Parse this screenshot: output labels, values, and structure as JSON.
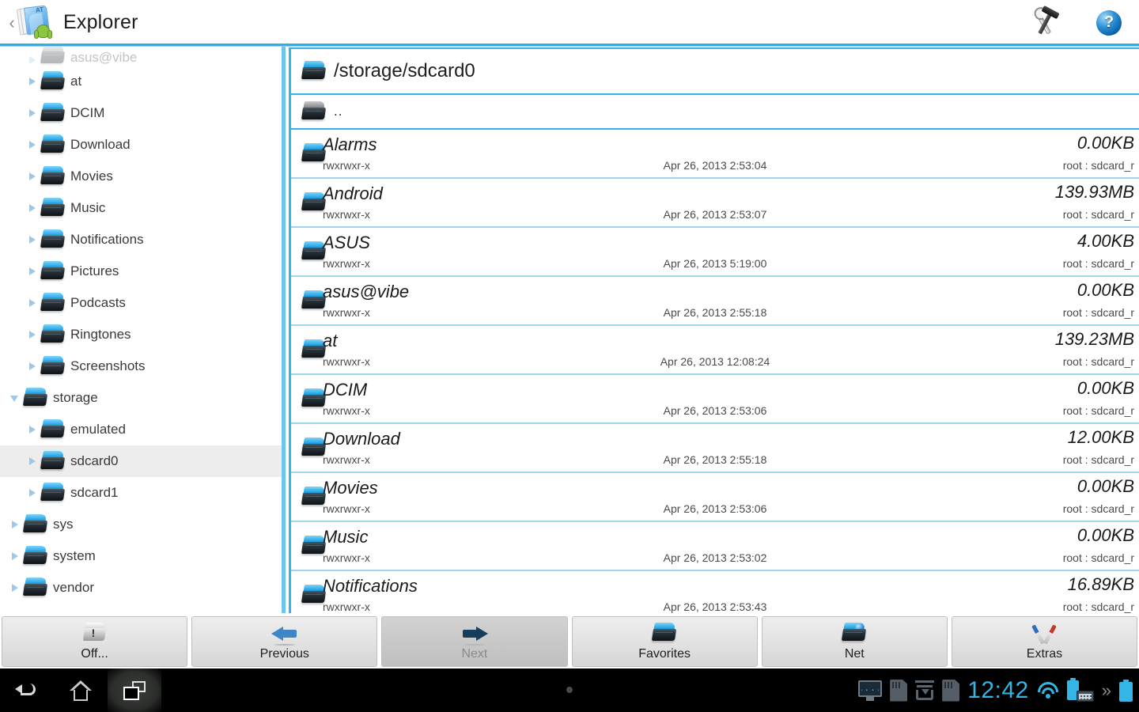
{
  "titlebar": {
    "back_chevron": "‹",
    "app_name": "Explorer",
    "app_icon": "explorer-app-icon",
    "tools_icon": "tools-icon",
    "help_icon": "help-icon",
    "help_glyph": "?",
    "at_badge": "AT"
  },
  "sidebar": {
    "items": [
      {
        "label": "asus@vibe",
        "indent": 1,
        "caret": "closed",
        "partial": true,
        "selected": false
      },
      {
        "label": "at",
        "indent": 1,
        "caret": "closed",
        "partial": false,
        "selected": false
      },
      {
        "label": "DCIM",
        "indent": 1,
        "caret": "closed",
        "partial": false,
        "selected": false
      },
      {
        "label": "Download",
        "indent": 1,
        "caret": "closed",
        "partial": false,
        "selected": false
      },
      {
        "label": "Movies",
        "indent": 1,
        "caret": "closed",
        "partial": false,
        "selected": false
      },
      {
        "label": "Music",
        "indent": 1,
        "caret": "closed",
        "partial": false,
        "selected": false
      },
      {
        "label": "Notifications",
        "indent": 1,
        "caret": "closed",
        "partial": false,
        "selected": false
      },
      {
        "label": "Pictures",
        "indent": 1,
        "caret": "closed",
        "partial": false,
        "selected": false
      },
      {
        "label": "Podcasts",
        "indent": 1,
        "caret": "closed",
        "partial": false,
        "selected": false
      },
      {
        "label": "Ringtones",
        "indent": 1,
        "caret": "closed",
        "partial": false,
        "selected": false
      },
      {
        "label": "Screenshots",
        "indent": 1,
        "caret": "closed",
        "partial": false,
        "selected": false
      },
      {
        "label": "storage",
        "indent": 0,
        "caret": "open",
        "partial": false,
        "selected": false
      },
      {
        "label": "emulated",
        "indent": 1,
        "caret": "closed",
        "partial": false,
        "selected": false
      },
      {
        "label": "sdcard0",
        "indent": 1,
        "caret": "closed",
        "partial": false,
        "selected": true
      },
      {
        "label": "sdcard1",
        "indent": 1,
        "caret": "closed",
        "partial": false,
        "selected": false
      },
      {
        "label": "sys",
        "indent": 0,
        "caret": "closed",
        "partial": false,
        "selected": false
      },
      {
        "label": "system",
        "indent": 0,
        "caret": "closed",
        "partial": false,
        "selected": false
      },
      {
        "label": "vendor",
        "indent": 0,
        "caret": "closed",
        "partial": false,
        "selected": false
      }
    ]
  },
  "content": {
    "path": "/storage/sdcard0",
    "path_icon": "folder-icon",
    "parent_label": "..",
    "parent_icon": "folder-up-icon",
    "rows": [
      {
        "name": "Alarms",
        "perm": "rwxrwxr-x",
        "date": "Apr 26, 2013 2:53:04",
        "size": "0.00KB",
        "owner": "root : sdcard_r"
      },
      {
        "name": "Android",
        "perm": "rwxrwxr-x",
        "date": "Apr 26, 2013 2:53:07",
        "size": "139.93MB",
        "owner": "root : sdcard_r"
      },
      {
        "name": "ASUS",
        "perm": "rwxrwxr-x",
        "date": "Apr 26, 2013 5:19:00",
        "size": "4.00KB",
        "owner": "root : sdcard_r"
      },
      {
        "name": "asus@vibe",
        "perm": "rwxrwxr-x",
        "date": "Apr 26, 2013 2:55:18",
        "size": "0.00KB",
        "owner": "root : sdcard_r"
      },
      {
        "name": "at",
        "perm": "rwxrwxr-x",
        "date": "Apr 26, 2013 12:08:24",
        "size": "139.23MB",
        "owner": "root : sdcard_r"
      },
      {
        "name": "DCIM",
        "perm": "rwxrwxr-x",
        "date": "Apr 26, 2013 2:53:06",
        "size": "0.00KB",
        "owner": "root : sdcard_r"
      },
      {
        "name": "Download",
        "perm": "rwxrwxr-x",
        "date": "Apr 26, 2013 2:55:18",
        "size": "12.00KB",
        "owner": "root : sdcard_r"
      },
      {
        "name": "Movies",
        "perm": "rwxrwxr-x",
        "date": "Apr 26, 2013 2:53:06",
        "size": "0.00KB",
        "owner": "root : sdcard_r"
      },
      {
        "name": "Music",
        "perm": "rwxrwxr-x",
        "date": "Apr 26, 2013 2:53:02",
        "size": "0.00KB",
        "owner": "root : sdcard_r"
      },
      {
        "name": "Notifications",
        "perm": "rwxrwxr-x",
        "date": "Apr 26, 2013 2:53:43",
        "size": "16.89KB",
        "owner": "root : sdcard_r"
      }
    ]
  },
  "toolbar": {
    "buttons": [
      {
        "label": "Off...",
        "icon": "off-icon",
        "disabled": false
      },
      {
        "label": "Previous",
        "icon": "arrow-left-icon",
        "disabled": false
      },
      {
        "label": "Next",
        "icon": "arrow-right-icon",
        "disabled": true
      },
      {
        "label": "Favorites",
        "icon": "folder-icon",
        "disabled": false
      },
      {
        "label": "Net",
        "icon": "folder-net-icon",
        "disabled": false
      },
      {
        "label": "Extras",
        "icon": "extras-icon",
        "disabled": false
      }
    ]
  },
  "navbar": {
    "back_icon": "back-icon",
    "home_icon": "home-icon",
    "recents_icon": "recents-icon",
    "status": {
      "monitor_icon": "system-monitor-icon",
      "sd1_icon": "sd-card-icon",
      "download_icon": "download-tray-icon",
      "sd2_icon": "sd-card-icon",
      "clock": "12:42",
      "wifi_icon": "wifi-icon",
      "battery_keyboard_icon": "battery-keyboard-icon",
      "more_glyph": "»",
      "battery_icon": "battery-icon"
    }
  },
  "colors": {
    "accent_blue": "#35b4e8",
    "divider_blue": "#9fd6ef",
    "status_cyan": "#33b5e5",
    "selected_row": "#ededed"
  }
}
